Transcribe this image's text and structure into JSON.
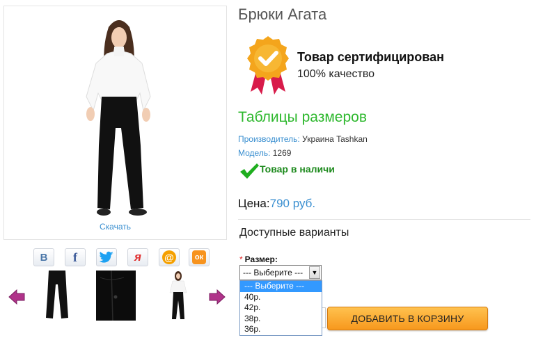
{
  "product": {
    "title": "Брюки Агата",
    "download_label": "Скачать",
    "certificate_title": "Товар сертифицирован",
    "certificate_subtitle": "100% качество",
    "sizes_table_link": "Таблицы размеров",
    "manufacturer_label": "Производитель:",
    "manufacturer_value": "Украина Tashkan",
    "model_label": "Модель:",
    "model_value": "1269",
    "stock_text": "Товар в наличи",
    "price_label": "Цена:",
    "price_value": "790 руб."
  },
  "social_buttons": [
    {
      "name": "vkontakte",
      "glyph": "В",
      "color": "#4a76a8"
    },
    {
      "name": "facebook",
      "glyph": "f",
      "color": "#3b5998"
    },
    {
      "name": "twitter",
      "glyph": "",
      "color": "#1da1f2"
    },
    {
      "name": "moi-krug",
      "glyph": "я",
      "color": "#e03030"
    },
    {
      "name": "mail-ru",
      "glyph": "@",
      "color": "#f5a000"
    },
    {
      "name": "odnoklassniki",
      "glyph": "ок",
      "color": "#f7931e"
    }
  ],
  "variants": {
    "title": "Доступные варианты",
    "size_label": "Размер:",
    "required_mark": "*",
    "selected": "--- Выберите ---",
    "options": [
      "--- Выберите ---",
      "40р.",
      "42р.",
      "38р.",
      "36р."
    ]
  },
  "cart": {
    "button_label": "ДОБАВИТЬ В КОРЗИНУ"
  },
  "colors": {
    "accent_blue": "#3a8fd0",
    "green": "#2eb82e",
    "cart_orange": "#f7981d"
  }
}
